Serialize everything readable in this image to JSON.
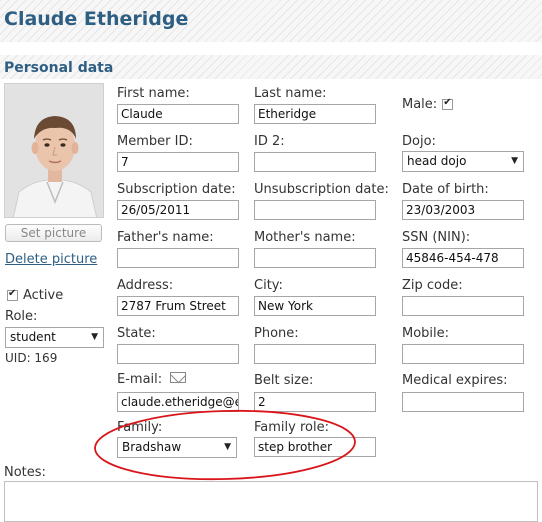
{
  "header": {
    "title": "Claude Etheridge"
  },
  "section": {
    "title": "Personal data"
  },
  "photo": {
    "button": "Set picture",
    "delete": "Delete picture"
  },
  "sidebar": {
    "active_label": "Active",
    "role_label": "Role:",
    "role_value": "student",
    "uid": "UID: 169"
  },
  "fields": {
    "first_name": {
      "label": "First name:",
      "value": "Claude"
    },
    "last_name": {
      "label": "Last name:",
      "value": "Etheridge"
    },
    "male": {
      "label": "Male:",
      "checked": true
    },
    "member_id": {
      "label": "Member ID:",
      "value": "7"
    },
    "id2": {
      "label": "ID 2:",
      "value": ""
    },
    "dojo": {
      "label": "Dojo:",
      "value": "head dojo"
    },
    "subscription_date": {
      "label": "Subscription date:",
      "value": "26/05/2011"
    },
    "unsubscription_date": {
      "label": "Unsubscription date:",
      "value": ""
    },
    "date_of_birth": {
      "label": "Date of birth:",
      "value": "23/03/2003"
    },
    "fathers_name": {
      "label": "Father's name:",
      "value": ""
    },
    "mothers_name": {
      "label": "Mother's name:",
      "value": ""
    },
    "ssn": {
      "label": "SSN (NIN):",
      "value": "45846-454-478"
    },
    "address": {
      "label": "Address:",
      "value": "2787 Frum Street"
    },
    "city": {
      "label": "City:",
      "value": "New York"
    },
    "zip": {
      "label": "Zip code:",
      "value": ""
    },
    "state": {
      "label": "State:",
      "value": ""
    },
    "phone": {
      "label": "Phone:",
      "value": ""
    },
    "mobile": {
      "label": "Mobile:",
      "value": ""
    },
    "email": {
      "label": "E-mail:",
      "value": "claude.etheridge@ex"
    },
    "belt_size": {
      "label": "Belt size:",
      "value": "2"
    },
    "medical_expires": {
      "label": "Medical expires:",
      "value": ""
    },
    "family": {
      "label": "Family:",
      "value": "Bradshaw"
    },
    "family_role": {
      "label": "Family role:",
      "value": "step brother"
    }
  },
  "notes": {
    "label": "Notes:",
    "value": ""
  },
  "icons": {
    "email": "envelope-icon",
    "dropdown": "chevron-down-icon",
    "checkbox": "checkmark-icon"
  },
  "colors": {
    "heading": "#2e5f83",
    "annotation": "#d9151b"
  }
}
